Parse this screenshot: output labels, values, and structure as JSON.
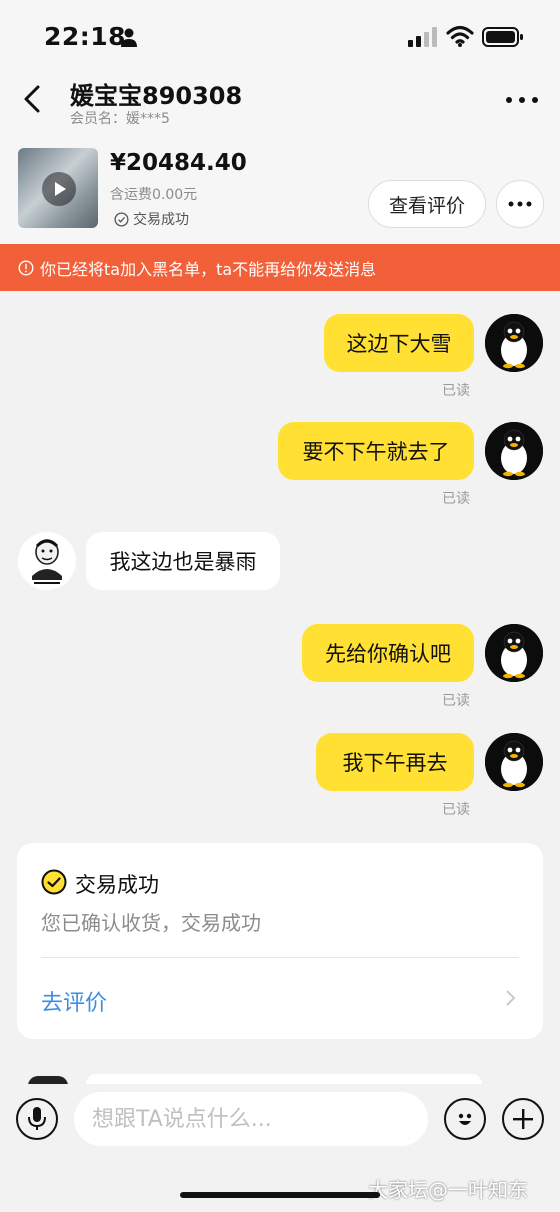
{
  "status_bar": {
    "time": "22:18"
  },
  "header": {
    "contact_name": "媛宝宝890308",
    "member_label": "会员名：媛***5"
  },
  "product": {
    "price": "¥20484.40",
    "shipping": "含运费0.00元",
    "deal_status": "交易成功",
    "review_button": "查看评价"
  },
  "banner": {
    "text": "你已经将ta加入黑名单，ta不能再给你发送消息"
  },
  "messages": [
    {
      "from": "me",
      "text": "这边下大雪",
      "read": "已读"
    },
    {
      "from": "me",
      "text": "要不下午就去了",
      "read": "已读"
    },
    {
      "from": "other",
      "text": "我这边也是暴雨"
    },
    {
      "from": "me",
      "text": "先给你确认吧",
      "read": "已读"
    },
    {
      "from": "me",
      "text": "我下午再去",
      "read": "已读"
    }
  ],
  "deal_card": {
    "title": "交易成功",
    "description": "您已确认收货，交易成功",
    "link": "去评价"
  },
  "input": {
    "placeholder": "想跟TA说点什么..."
  },
  "watermark": "大家坛@一叶知东",
  "colors": {
    "bubble_me": "#ffe033",
    "banner": "#f2603a",
    "link": "#3a8ee6"
  }
}
